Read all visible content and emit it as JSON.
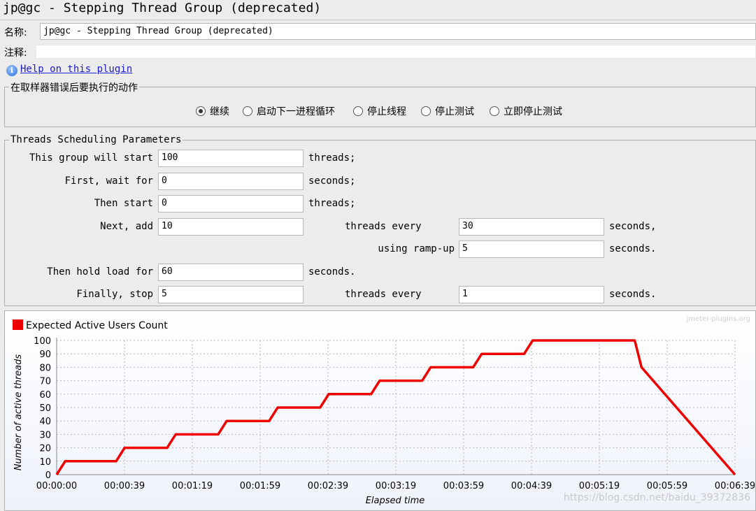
{
  "window": {
    "title": "jp@gc - Stepping Thread Group (deprecated)"
  },
  "name_row": {
    "label": "名称:",
    "value": "jp@gc - Stepping Thread Group (deprecated)"
  },
  "comment_row": {
    "label": "注释:",
    "value": ""
  },
  "help": {
    "icon": "info-icon",
    "link_text": "Help on this plugin"
  },
  "error_action": {
    "title": "在取样器错误后要执行的动作",
    "options": [
      {
        "label": "继续",
        "checked": true
      },
      {
        "label": "启动下一进程循环",
        "checked": false
      },
      {
        "label": "停止线程",
        "checked": false
      },
      {
        "label": "停止测试",
        "checked": false
      },
      {
        "label": "立即停止测试",
        "checked": false
      }
    ]
  },
  "scheduling": {
    "title": "Threads Scheduling Parameters",
    "start_label": "This group will start",
    "start_value": "100",
    "start_unit": "threads;",
    "wait_label": "First, wait for",
    "wait_value": "0",
    "wait_unit": "seconds;",
    "then_start_label": "Then start",
    "then_start_value": "0",
    "then_start_unit": "threads;",
    "next_add_label": "Next, add",
    "next_add_value": "10",
    "threads_every_label": "threads every",
    "threads_every_value": "30",
    "threads_every_unit": "seconds,",
    "ramp_up_label": "using ramp-up",
    "ramp_up_value": "5",
    "ramp_up_unit": "seconds.",
    "hold_label": "Then hold load for",
    "hold_value": "60",
    "hold_unit": "seconds.",
    "stop_label": "Finally, stop",
    "stop_value": "5",
    "stop_every_label": "threads every",
    "stop_every_value": "1",
    "stop_every_unit": "seconds."
  },
  "watermark": "jmeter-plugins.org",
  "url_watermark": "https://blog.csdn.net/baidu_39372836",
  "chart_data": {
    "type": "line",
    "legend": [
      "Expected Active Users Count"
    ],
    "legend_position": "top-left",
    "ylabel": "Number of active threads",
    "xlabel": "Elapsed time",
    "ylim": [
      0,
      100
    ],
    "xlim_seconds": [
      0,
      399
    ],
    "grid": true,
    "color": "#ee0000",
    "y_ticks": [
      "0",
      "10",
      "20",
      "30",
      "40",
      "50",
      "60",
      "70",
      "80",
      "90",
      "100"
    ],
    "x_ticks": [
      "00:00:00",
      "00:00:39",
      "00:01:19",
      "00:01:59",
      "00:02:39",
      "00:03:19",
      "00:03:59",
      "00:04:39",
      "00:05:19",
      "00:05:59",
      "00:06:39"
    ],
    "series": [
      {
        "name": "Expected Active Users Count",
        "x": [
          0,
          5,
          35,
          40,
          65,
          70,
          95,
          100,
          125,
          130,
          155,
          160,
          185,
          190,
          215,
          220,
          245,
          250,
          275,
          280,
          305,
          310,
          340,
          344,
          399
        ],
        "values": [
          0,
          10,
          10,
          20,
          20,
          30,
          30,
          40,
          40,
          50,
          50,
          60,
          60,
          70,
          70,
          80,
          80,
          90,
          90,
          100,
          100,
          100,
          100,
          80,
          0
        ]
      }
    ]
  }
}
